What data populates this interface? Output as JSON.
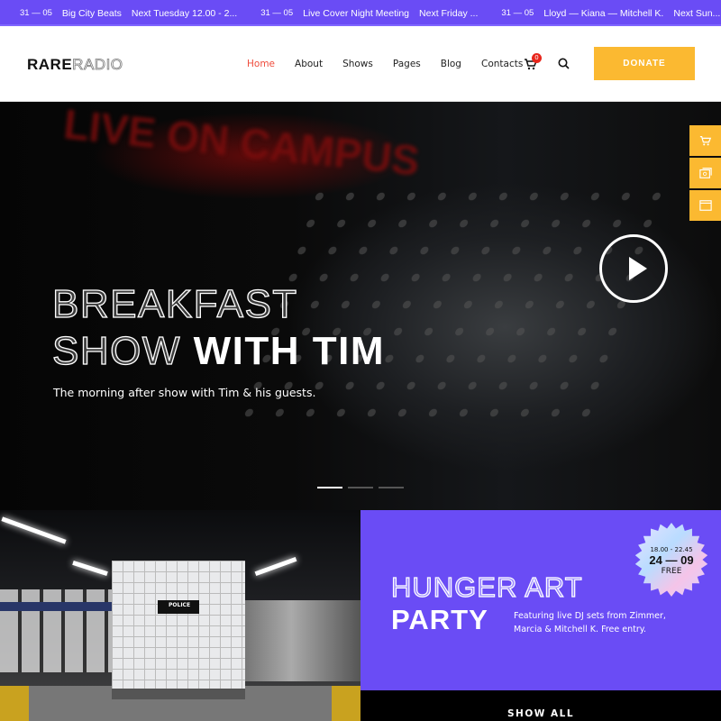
{
  "ticker": [
    {
      "date": "31 — 05",
      "title": "Big City Beats",
      "time": "Next Tuesday 12.00 - 2..."
    },
    {
      "date": "31 — 05",
      "title": "Live Cover Night Meeting",
      "time": "Next Friday ..."
    },
    {
      "date": "31 — 05",
      "title": "Lloyd — Kiana — Mitchell K.",
      "time": "Next Sun..."
    }
  ],
  "header": {
    "logo_bold": "RARE",
    "logo_outline": "RADIO",
    "nav": [
      "Home",
      "About",
      "Shows",
      "Pages",
      "Blog",
      "Contacts"
    ],
    "active_nav": "Home",
    "cart_count": "0",
    "donate_label": "DONATE"
  },
  "hero": {
    "neon_text": "LIVE ON CAMPUS",
    "title_outline_1": "BREAKFAST",
    "title_outline_2": "SHOW",
    "title_fill": "WITH TIM",
    "subtitle": "The morning after show with Tim & his guests.",
    "slides": 3,
    "active_slide": 1
  },
  "side_icons": [
    "cart-icon",
    "image-icon",
    "browser-icon"
  ],
  "photo": {
    "sign": "POLICE"
  },
  "event": {
    "title_outline": "HUNGER ART",
    "title_fill": "PARTY",
    "description": "Featuring live DJ sets from Zimmer, Marcia & Mitchell K. Free entry.",
    "time": "18.00 - 22.45",
    "date": "24 — 09",
    "price": "FREE"
  },
  "show_all_label": "SHOW ALL",
  "colors": {
    "accent": "#6a4cf5",
    "donate": "#fbb931",
    "active_nav": "#ef4b3b"
  }
}
